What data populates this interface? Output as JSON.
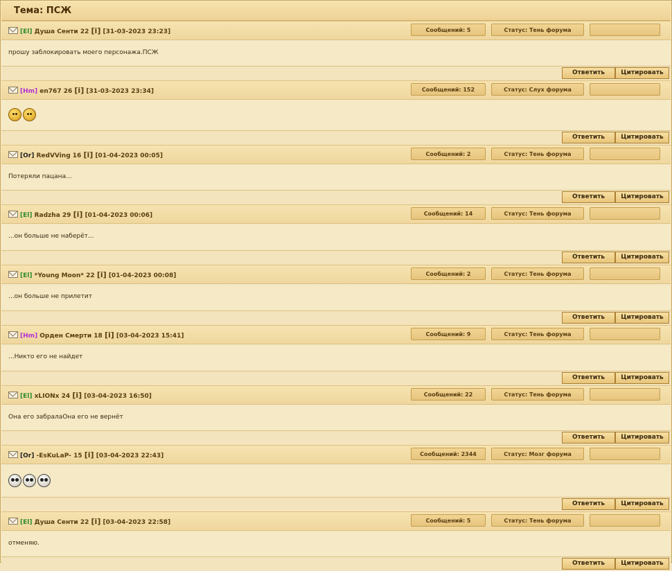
{
  "topic": {
    "title": "Тема: ПСЖ"
  },
  "buttons": {
    "reply": "Ответить",
    "quote": "Цитировать"
  },
  "posts": [
    {
      "race": "[El]",
      "race_class": "el",
      "name": "Душа Сенти",
      "level": "22",
      "info": "[i]",
      "datetime": "[31-03-2023 23:23]",
      "messages": "Сообщений: 5",
      "status": "Статус: Тень форума",
      "text": "прошу заблокировать моего персонажа.ПСЖ",
      "smileys": []
    },
    {
      "race": "[Hm]",
      "race_class": "hm",
      "name": "en767",
      "level": "26",
      "info": "[i]",
      "datetime": "[31-03-2023 23:34]",
      "messages": "Сообщений: 152",
      "status": "Статус: Слух форума",
      "text": "",
      "smileys": [
        "smiley-icon",
        "smiley-icon"
      ]
    },
    {
      "race": "[Or]",
      "race_class": "or",
      "name": "RedVVing",
      "level": "16",
      "info": "[i]",
      "datetime": "[01-04-2023 00:05]",
      "messages": "Сообщений: 2",
      "status": "Статус: Тень форума",
      "text": "Потеряли пацана...",
      "smileys": []
    },
    {
      "race": "[El]",
      "race_class": "el",
      "name": "Radzha",
      "level": "29",
      "info": "[i]",
      "datetime": "[01-04-2023 00:06]",
      "messages": "Сообщений: 14",
      "status": "Статус: Тень форума",
      "text": "...он больше не наберёт...",
      "smileys": []
    },
    {
      "race": "[El]",
      "race_class": "el",
      "name": "*Young Moon*",
      "level": "22",
      "info": "[i]",
      "datetime": "[01-04-2023 00:08]",
      "messages": "Сообщений: 2",
      "status": "Статус: Тень форума",
      "text": "...он больше не прилетит",
      "smileys": []
    },
    {
      "race": "[Hm]",
      "race_class": "hm",
      "name": "Орден Смерти",
      "level": "18",
      "info": "[i]",
      "datetime": "[03-04-2023 15:41]",
      "messages": "Сообщений: 9",
      "status": "Статус: Тень форума",
      "text": "...Никто его не найдет",
      "smileys": []
    },
    {
      "race": "[El]",
      "race_class": "el",
      "name": "xLIONx",
      "level": "24",
      "info": "[i]",
      "datetime": "[03-04-2023 16:50]",
      "messages": "Сообщений: 22",
      "status": "Статус: Тень форума",
      "text": "Она его забралаОна его не вернёт",
      "smileys": []
    },
    {
      "race": "[Or]",
      "race_class": "or",
      "name": "-EsKuLaP-",
      "level": "15",
      "info": "[i]",
      "datetime": "[03-04-2023 22:43]",
      "messages": "Сообщений: 2344",
      "status": "Статус: Мозг форума",
      "text": "",
      "smileys": [
        "panda-smiley-icon",
        "panda-smiley-icon",
        "panda-smiley-icon"
      ]
    },
    {
      "race": "[El]",
      "race_class": "el",
      "name": "Душа Сенти",
      "level": "22",
      "info": "[i]",
      "datetime": "[03-04-2023 22:58]",
      "messages": "Сообщений: 5",
      "status": "Статус: Тень форума",
      "text": "отменяю.",
      "smileys": []
    }
  ]
}
